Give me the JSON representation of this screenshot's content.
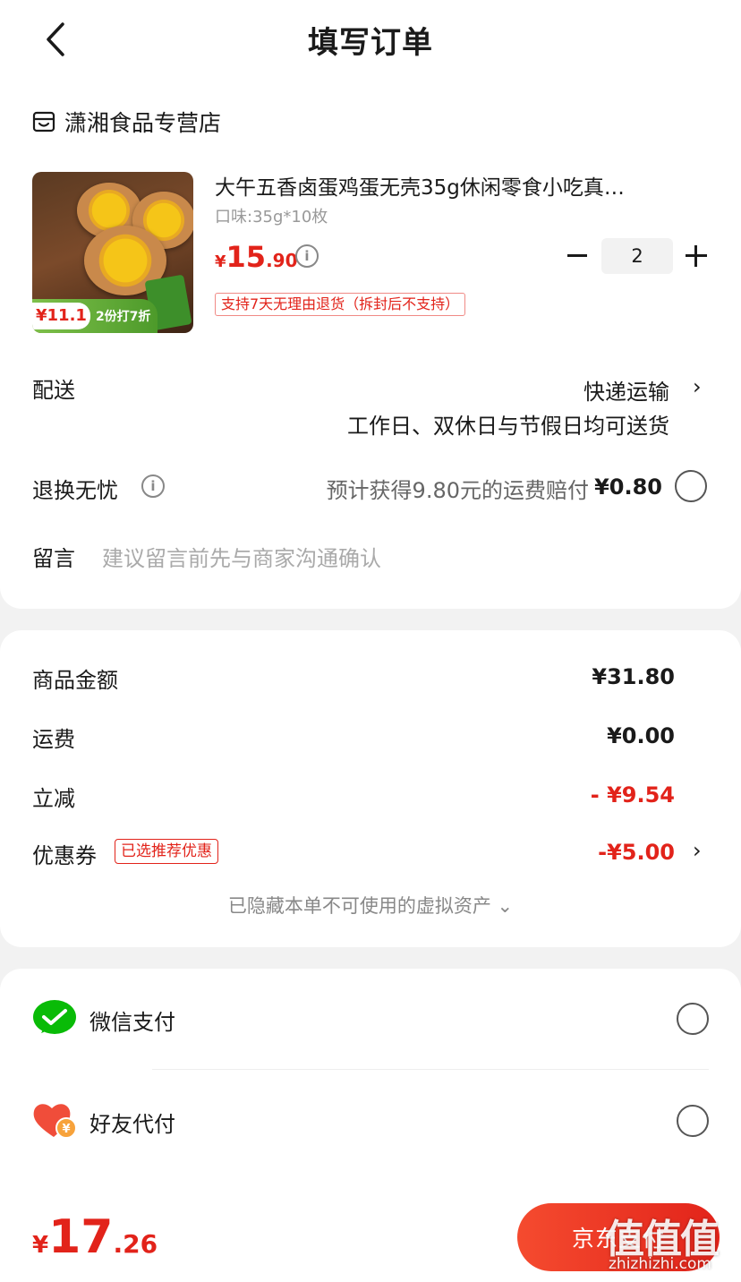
{
  "header": {
    "title": "填写订单"
  },
  "store": {
    "name": "潇湘食品专营店"
  },
  "product": {
    "title": "大午五香卤蛋鸡蛋无壳35g休闲零食小吃真…",
    "spec": "口味:35g*10枚",
    "price_symbol": "¥",
    "price_int": "15",
    "price_dec": ".90",
    "quantity": "2",
    "return_policy": "支持7天无理由退货（拆封后不支持）",
    "thumb_price": "¥11.1",
    "thumb_discount": "2份打7折"
  },
  "delivery": {
    "label": "配送",
    "method": "快递运输",
    "note": "工作日、双休日与节假日均可送货"
  },
  "worry_free": {
    "label": "退换无忧",
    "desc": "预计获得9.80元的运费赔付",
    "price": "¥0.80"
  },
  "message": {
    "label": "留言",
    "placeholder": "建议留言前先与商家沟通确认"
  },
  "summary": {
    "goods_label": "商品金额",
    "goods_value": "¥31.80",
    "shipping_label": "运费",
    "shipping_value": "¥0.00",
    "discount_label": "立减",
    "discount_value": "- ¥9.54",
    "coupon_label": "优惠券",
    "coupon_tag": "已选推荐优惠",
    "coupon_value": "-¥5.00",
    "hidden_assets": "已隐藏本单不可使用的虚拟资产 ⌄"
  },
  "payment": {
    "wechat": "微信支付",
    "friend": "好友代付"
  },
  "footer": {
    "total_symbol": "¥",
    "total_int": "17",
    "total_dec": ".26",
    "pay_button": "京东支付",
    "watermark": "值值值",
    "watermark_sub": "zhizhizhi.com"
  },
  "colors": {
    "accent": "#e2231a",
    "wechat": "#09bb07"
  }
}
